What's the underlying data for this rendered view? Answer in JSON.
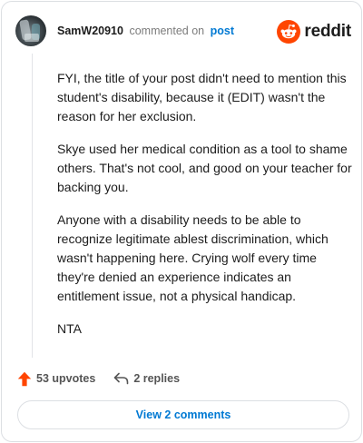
{
  "header": {
    "username": "SamW20910",
    "action_text": "commented on",
    "post_link": "post",
    "brand": "reddit"
  },
  "comment": {
    "paragraphs": [
      "FYI, the title of your post didn't need to mention this student's disability, because it (EDIT) wasn't the reason for her exclusion.",
      "Skye used her medical condition as a tool to shame others. That's not cool, and good on your teacher for backing you.",
      "Anyone with a disability needs to be able to recognize legitimate ablest discrimination, which wasn't happening here. Crying wolf every time they're denied an experience indicates an entitlement issue, not a physical handicap.",
      "NTA"
    ]
  },
  "actions": {
    "upvotes": "53 upvotes",
    "replies": "2 replies"
  },
  "footer": {
    "view_comments": "View 2 comments"
  },
  "colors": {
    "brand_orange": "#ff4500",
    "link_blue": "#0079d3",
    "upvote_orange": "#ff4500"
  },
  "icons": {
    "avatar": "user-avatar",
    "logo": "reddit-snoo-icon",
    "upvote": "upvote-arrow-icon",
    "reply": "reply-arrow-icon"
  }
}
